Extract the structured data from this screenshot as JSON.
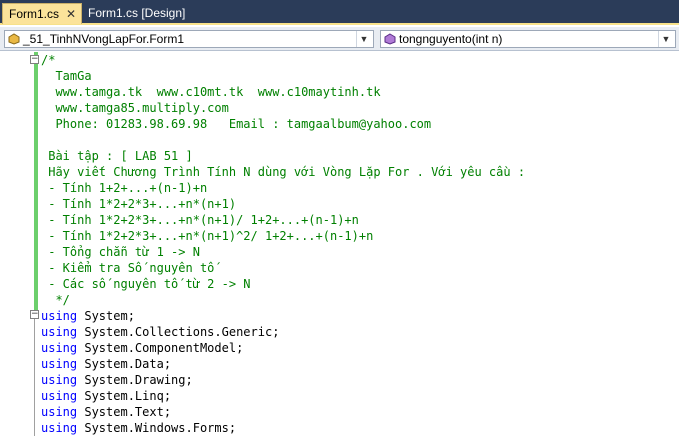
{
  "tabs": [
    {
      "label": "Form1.cs",
      "close": "✕"
    },
    {
      "label": "Form1.cs [Design]"
    }
  ],
  "nav": {
    "left_combo": "_51_TinhNVongLapFor.Form1",
    "right_combo": "tongnguyento(int n)"
  },
  "colors": {
    "comment": "#008000",
    "keyword": "#0000ff",
    "changebar": "#6ccf6c",
    "tab_active": "#fbe39a",
    "tabbar": "#2b3c59"
  },
  "code": {
    "comment_lines": [
      "/*",
      "  TamGa",
      "  www.tamga.tk  www.c10mt.tk  www.c10maytinh.tk",
      "  www.tamga85.multiply.com",
      "  Phone: 01283.98.69.98   Email : tamgaalbum@yahoo.com",
      "",
      " Bài tập : [ LAB 51 ]",
      " Hãy viết Chương Trình Tính N dùng với Vòng Lặp For . Với yêu cầu :",
      " - Tính 1+2+...+(n-1)+n",
      " - Tính 1*2+2*3+...+n*(n+1)",
      " - Tính 1*2+2*3+...+n*(n+1)/ 1+2+...+(n-1)+n",
      " - Tính 1*2+2*3+...+n*(n+1)^2/ 1+2+...+(n-1)+n",
      " - Tổng chẵn từ 1 -> N",
      " - Kiểm tra Số nguyên tố",
      " - Các số nguyên tố từ 2 -> N",
      "  */"
    ],
    "using_keyword": "using",
    "using_lines": [
      " System;",
      " System.Collections.Generic;",
      " System.ComponentModel;",
      " System.Data;",
      " System.Drawing;",
      " System.Linq;",
      " System.Text;",
      " System.Windows.Forms;"
    ]
  }
}
